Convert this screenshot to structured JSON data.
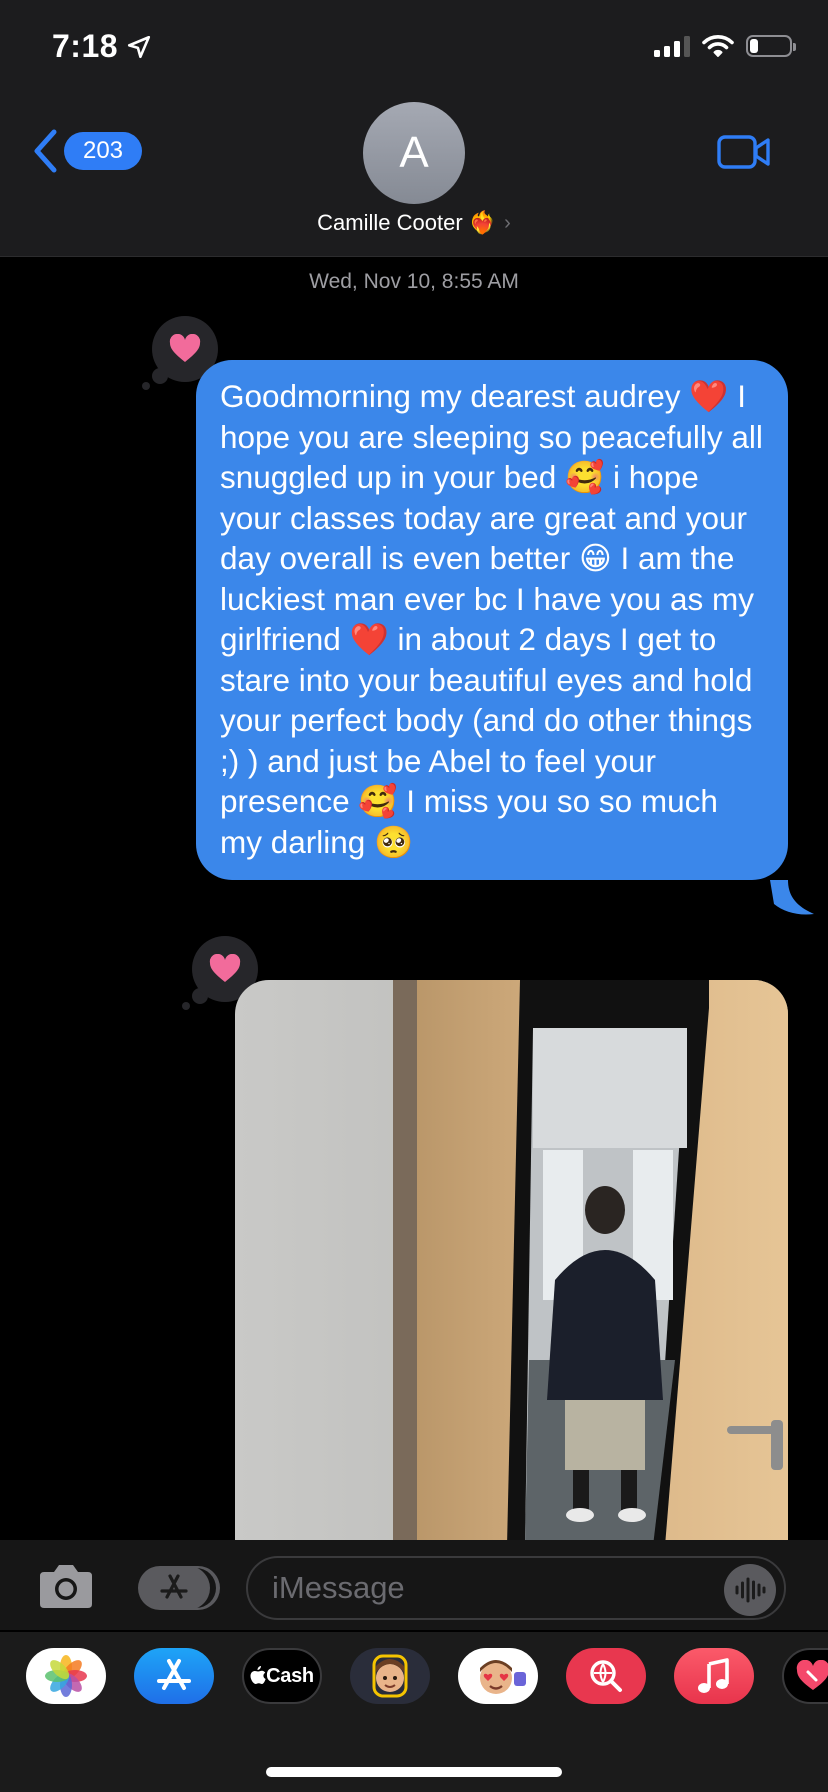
{
  "status_bar": {
    "time": "7:18",
    "battery_percent": 20
  },
  "header": {
    "back_badge": "203",
    "avatar_initial": "A",
    "contact_name": "Camille Cooter ❤️‍🔥",
    "chevron": "›"
  },
  "conversation": {
    "timestamp": "Wed, Nov 10, 8:55 AM",
    "messages": [
      {
        "type": "text",
        "sender": "me",
        "text": "Goodmorning my dearest audrey ❤️ I hope you are sleeping so peacefully all snuggled up in your bed 🥰 i hope your classes today are great and your day overall is even better 😁 I am the luckiest man ever bc I have you as my girlfriend ❤️ in about 2 days I get to stare into your beautiful eyes and hold your perfect body (and do other things ;) ) and just be Abel to feel your presence 🥰 I miss you so so much my darling 🥺",
        "tapback": "heart"
      },
      {
        "type": "image",
        "sender": "me",
        "tapback": "heart"
      }
    ]
  },
  "compose": {
    "placeholder": "iMessage"
  },
  "app_drawer": {
    "apps": [
      {
        "name": "Photos",
        "icon": "photos-icon"
      },
      {
        "name": "App Store",
        "icon": "app-store-icon"
      },
      {
        "name": "Cash",
        "label": "Cash",
        "icon": "apple-cash-icon"
      },
      {
        "name": "Memoji",
        "icon": "memoji-icon"
      },
      {
        "name": "Memoji Stickers",
        "icon": "memoji-stickers-icon"
      },
      {
        "name": "Images",
        "icon": "image-search-icon"
      },
      {
        "name": "Music",
        "icon": "music-icon"
      },
      {
        "name": "Digital Touch",
        "icon": "digital-touch-icon"
      }
    ]
  },
  "colors": {
    "imessage_blue": "#3b87ea",
    "accent_blue": "#2f7df6",
    "tapback_heart": "#f26b9b",
    "header_bg": "#1c1c1e"
  }
}
